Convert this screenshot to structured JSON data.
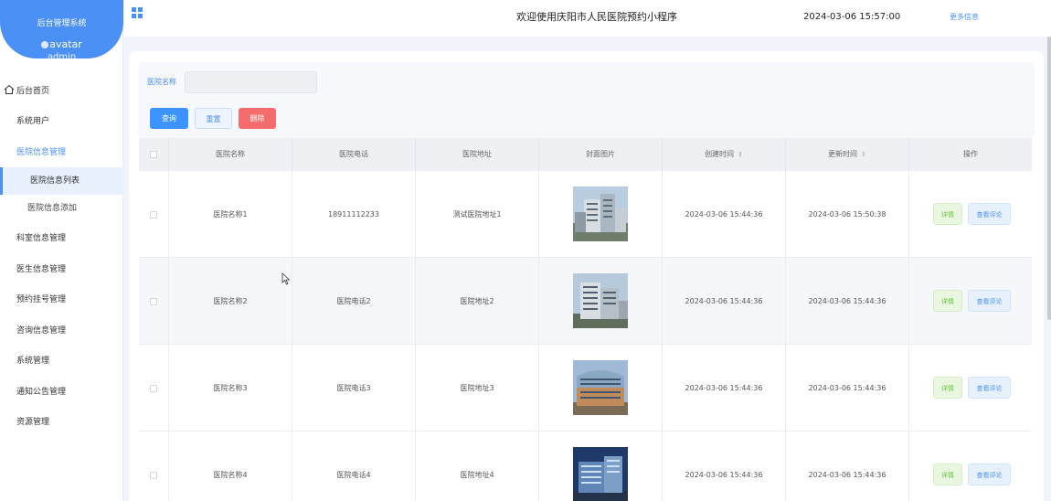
{
  "sidebar": {
    "brand_title": "后台管理系统",
    "avatar_alt": "avatar",
    "username": "admin",
    "items": [
      {
        "label": "后台首页",
        "icon": "home-icon"
      },
      {
        "label": "系统用户"
      },
      {
        "label": "医院信息管理"
      },
      {
        "label": "医院信息列表"
      },
      {
        "label": "医院信息添加"
      },
      {
        "label": "科室信息管理"
      },
      {
        "label": "医生信息管理"
      },
      {
        "label": "预约挂号管理"
      },
      {
        "label": "咨询信息管理"
      },
      {
        "label": "系统管理"
      },
      {
        "label": "通知公告管理"
      },
      {
        "label": "资源管理"
      }
    ]
  },
  "header": {
    "title": "欢迎使用庆阳市人民医院预约小程序",
    "time": "2024-03-06 15:57:00",
    "more": "更多信息"
  },
  "search": {
    "label": "医院名称",
    "value": "",
    "query": "查询",
    "reset": "重置",
    "delete": "删除"
  },
  "table": {
    "headers": [
      "医院名称",
      "医院电话",
      "医院地址",
      "封面图片",
      "创建时间",
      "更新时间",
      "操作"
    ],
    "rows": [
      {
        "name": "医院名称1",
        "phone": "18911112233",
        "address": "测试医院地址1",
        "created": "2024-03-06 15:44:36",
        "updated": "2024-03-06 15:50:38"
      },
      {
        "name": "医院名称2",
        "phone": "医院电话2",
        "address": "医院地址2",
        "created": "2024-03-06 15:44:36",
        "updated": "2024-03-06 15:44:36"
      },
      {
        "name": "医院名称3",
        "phone": "医院电话3",
        "address": "医院地址3",
        "created": "2024-03-06 15:44:36",
        "updated": "2024-03-06 15:44:36"
      },
      {
        "name": "医院名称4",
        "phone": "医院电话4",
        "address": "医院地址4",
        "created": "2024-03-06 15:44:36",
        "updated": "2024-03-06 15:44:36"
      }
    ],
    "detail_label": "详情",
    "review_label": "查看评论"
  },
  "colors": {
    "primary": "#4b90f5",
    "danger": "#f56c6c",
    "success": "#67c23a"
  }
}
